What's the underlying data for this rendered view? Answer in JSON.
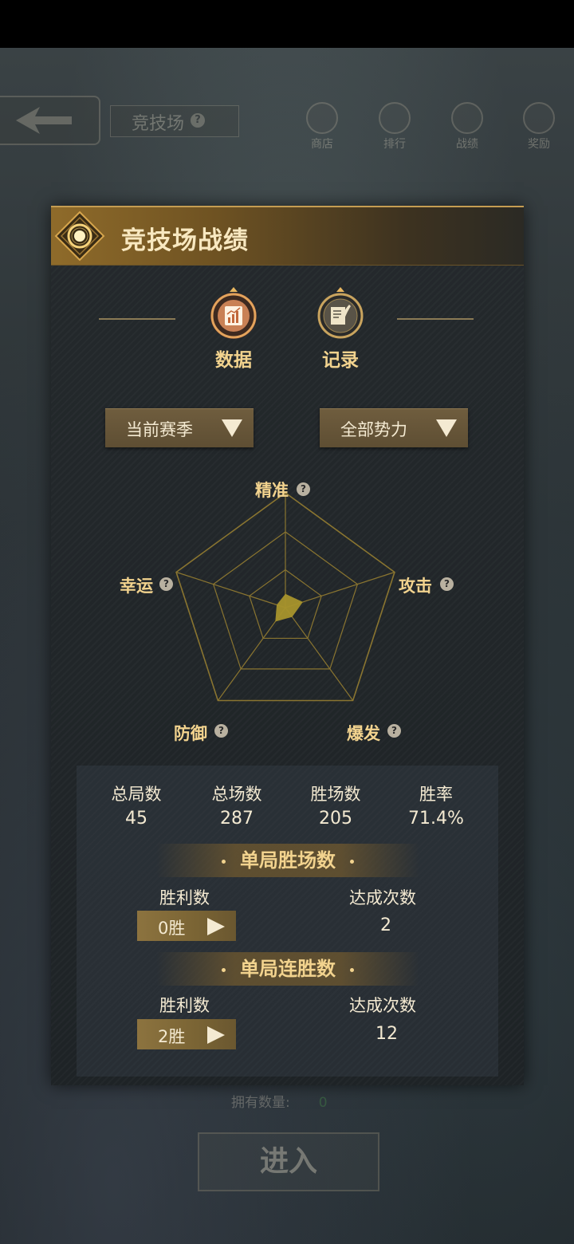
{
  "top_bar": {
    "title": "竞技场",
    "help": "?",
    "nav": [
      {
        "label": "商店",
        "icon": "shop-icon"
      },
      {
        "label": "排行",
        "icon": "trophy-icon"
      },
      {
        "label": "战绩",
        "icon": "record-shield-icon"
      },
      {
        "label": "奖励",
        "icon": "reward-icon"
      }
    ]
  },
  "panel": {
    "title": "竞技场战绩",
    "tabs": [
      {
        "label": "数据",
        "icon": "chart-icon"
      },
      {
        "label": "记录",
        "icon": "quill-icon"
      }
    ],
    "dropdowns": {
      "season": "当前赛季",
      "faction": "全部势力"
    },
    "radar": {
      "labels": {
        "top": "精准",
        "right": "攻击",
        "bottom_right": "爆发",
        "bottom_left": "防御",
        "left": "幸运"
      },
      "help": "?"
    },
    "stats": [
      {
        "name": "总局数",
        "value": "45"
      },
      {
        "name": "总场数",
        "value": "287"
      },
      {
        "name": "胜场数",
        "value": "205"
      },
      {
        "name": "胜率",
        "value": "71.4%"
      }
    ],
    "section_single_wins": {
      "title": "单局胜场数",
      "col_wins": "胜利数",
      "col_count": "达成次数",
      "win_value": "0胜",
      "count_value": "2"
    },
    "section_streak": {
      "title": "单局连胜数",
      "col_wins": "胜利数",
      "col_count": "达成次数",
      "win_value": "2胜",
      "count_value": "12"
    }
  },
  "bottom": {
    "owned_label": "拥有数量:",
    "owned_value": "0",
    "enter": "进入"
  },
  "chart_data": {
    "type": "radar",
    "axes": [
      "精准",
      "攻击",
      "爆发",
      "防御",
      "幸运"
    ],
    "values": [
      0.12,
      0.16,
      0.1,
      0.15,
      0.08
    ],
    "range": [
      0,
      1
    ]
  },
  "colors": {
    "accent_gold": "#f2d38e",
    "radar_fill": "#a8942c",
    "radar_lines": "#8a7530"
  }
}
